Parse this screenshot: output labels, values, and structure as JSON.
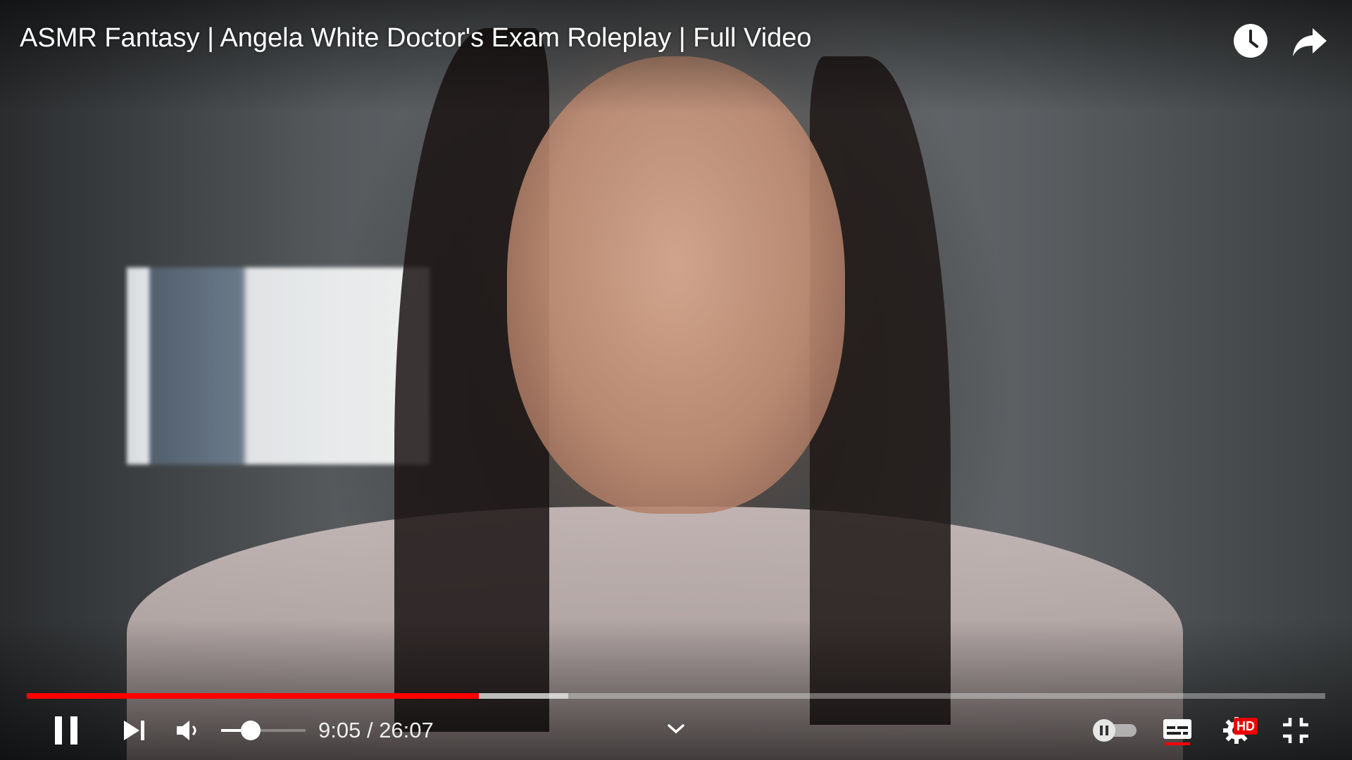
{
  "video": {
    "title": "ASMR Fantasy | Angela White Doctor's Exam Roleplay | Full Video"
  },
  "top_actions": [
    {
      "name": "watch-later",
      "icon": "clock-icon"
    },
    {
      "name": "share",
      "icon": "share-arrow-icon"
    }
  ],
  "player": {
    "current_time": "9:05",
    "separator": " / ",
    "duration": "26:07",
    "progress_played_fraction": 0.348,
    "progress_buffered_fraction": 0.417,
    "volume_fraction": 0.35,
    "quality_badge": "HD",
    "subtitles_active": true,
    "autoplay_enabled": false
  },
  "colors": {
    "accent": "#ff0000",
    "badge": "#e00000",
    "text": "#ffffff"
  }
}
